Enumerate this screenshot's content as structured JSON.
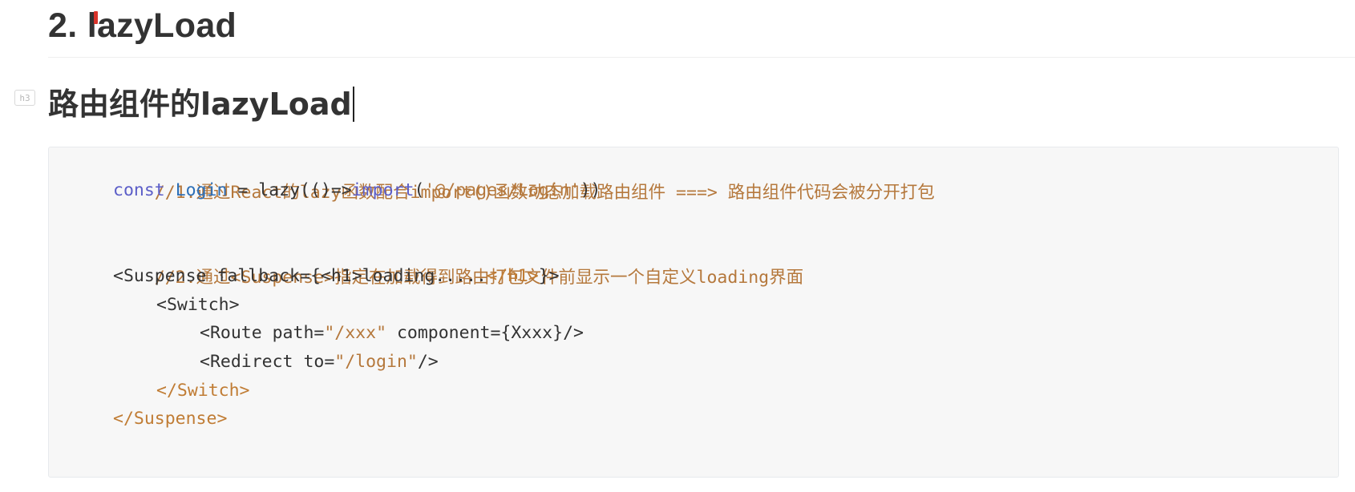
{
  "heading_h2": "2. lazyLoad",
  "heading_h3_badge": "h3",
  "heading_h3": "路由组件的lazyLoad",
  "code": {
    "line1_comment": "//1.通过React的lazy函数配合import()函数动态加载路由组件 ===> 路由组件代码会被分开打包",
    "line2_const": "const",
    "line2_name": "Login",
    "line2_eq": " = lazy(()=>",
    "line2_import": "import",
    "line2_open": "(",
    "line2_string": "'@/pages/Login'",
    "line2_close": "))",
    "line4_comment": "//2.通过<Suspense>指定在加载得到路由打包文件前显示一个自定义loading界面",
    "line5_open": "<Suspense fallback={<h1>loading.....",
    "line5_close_tag": "</h1>",
    "line5_end": "}>",
    "line6": "<Switch>",
    "line7_open": "<Route path=",
    "line7_path": "\"/xxx\"",
    "line7_rest": " component={Xxxx}/>",
    "line8_open": "<Redirect to=",
    "line8_path": "\"/login\"",
    "line8_rest": "/>",
    "line9": "</Switch>",
    "line10": "</Suspense>"
  },
  "colors": {
    "comment": "#b5783c",
    "keyword": "#5c5ec8",
    "definition": "#2d6fb7",
    "heading": "#333333",
    "code_background": "#f7f7f7"
  }
}
